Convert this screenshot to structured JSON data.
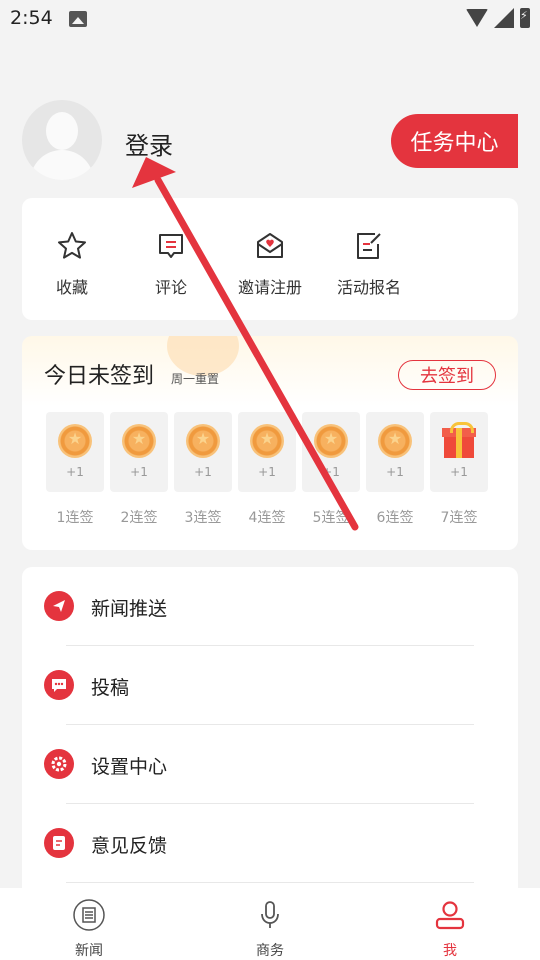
{
  "status_bar": {
    "time": "2:54"
  },
  "profile": {
    "login_label": "登录",
    "task_center_label": "任务中心"
  },
  "quick_actions": [
    {
      "label": "收藏",
      "icon": "star-icon"
    },
    {
      "label": "评论",
      "icon": "comment-icon"
    },
    {
      "label": "邀请注册",
      "icon": "invite-envelope-icon"
    },
    {
      "label": "活动报名",
      "icon": "signup-form-icon"
    }
  ],
  "checkin": {
    "title": "今日未签到",
    "subtitle": "周一重置",
    "button_label": "去签到",
    "days": [
      {
        "reward": "+1",
        "label": "1连签",
        "icon": "coin-icon"
      },
      {
        "reward": "+1",
        "label": "2连签",
        "icon": "coin-icon"
      },
      {
        "reward": "+1",
        "label": "3连签",
        "icon": "coin-icon"
      },
      {
        "reward": "+1",
        "label": "4连签",
        "icon": "coin-icon"
      },
      {
        "reward": "+1",
        "label": "5连签",
        "icon": "coin-icon"
      },
      {
        "reward": "+1",
        "label": "6连签",
        "icon": "coin-icon"
      },
      {
        "reward": "+1",
        "label": "7连签",
        "icon": "gift-icon"
      }
    ]
  },
  "menu": [
    {
      "label": "新闻推送",
      "icon": "paper-plane-icon"
    },
    {
      "label": "投稿",
      "icon": "message-icon"
    },
    {
      "label": "设置中心",
      "icon": "settings-icon"
    },
    {
      "label": "意见反馈",
      "icon": "feedback-icon"
    }
  ],
  "tabbar": [
    {
      "label": "新闻",
      "icon": "newspaper-icon",
      "active": false
    },
    {
      "label": "商务",
      "icon": "microphone-icon",
      "active": false
    },
    {
      "label": "我",
      "icon": "user-icon",
      "active": true
    }
  ],
  "colors": {
    "accent": "#e4343e",
    "background": "#f3f3f3",
    "annotation_arrow": "#e4343e"
  }
}
